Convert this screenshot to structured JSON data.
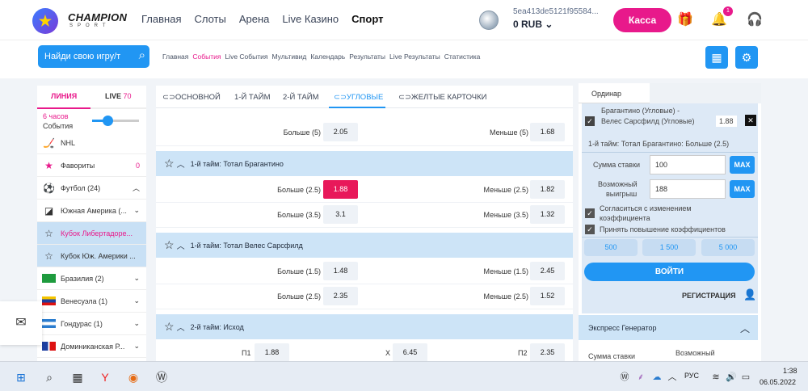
{
  "header": {
    "logo_title": "CHAMPION",
    "logo_sub": "SPORT",
    "nav": [
      "Главная",
      "Слоты",
      "Арена",
      "Live Казино",
      "Спорт"
    ],
    "account_id": "5ea413de5121f95584...",
    "balance": "0 RUB",
    "cashier": "Касса",
    "notif_count": "1"
  },
  "subheader": {
    "search": "Найди свою игру/т",
    "links": [
      "Главная",
      "События",
      "Live События",
      "Мультивид",
      "Календарь",
      "Результаты",
      "Live Результаты",
      "Статистика"
    ],
    "active_link": "События"
  },
  "left": {
    "tab_line": "ЛИНИЯ",
    "tab_live": "LIVE",
    "live_count": "70",
    "period": "6 часов",
    "events": "События",
    "items": [
      {
        "label": "NHL",
        "right": ""
      },
      {
        "label": "Фавориты",
        "right": "0"
      },
      {
        "label": "Футбол (24)",
        "right": "^"
      },
      {
        "label": "Южная Америка (...",
        "right": "v"
      },
      {
        "label": "Кубок Либертадоре...",
        "right": ""
      },
      {
        "label": "Кубок Юж. Америки ...",
        "right": ""
      },
      {
        "label": "Бразилия (2)",
        "right": "v"
      },
      {
        "label": "Венесуэла (1)",
        "right": "v"
      },
      {
        "label": "Гондурас (1)",
        "right": "v"
      },
      {
        "label": "Доминиканская Р...",
        "right": "v"
      }
    ]
  },
  "center": {
    "tabs": [
      "ОСНОВНОЙ",
      "1-Й ТАЙМ",
      "2-Й ТАЙМ",
      "УГЛОВЫЕ",
      "ЖЕЛТЫЕ КАРТОЧКИ"
    ],
    "active_tab": "УГЛОВЫЕ",
    "top_row": {
      "l_label": "Больше (5)",
      "l_val": "2.05",
      "r_label": "Меньше (5)",
      "r_val": "1.68"
    },
    "groups": [
      {
        "title": "1-й тайм: Тотал Брагантино",
        "rows": [
          {
            "l_label": "Больше (2.5)",
            "l_val": "1.88",
            "r_label": "Меньше (2.5)",
            "r_val": "1.82"
          },
          {
            "l_label": "Больше (3.5)",
            "l_val": "3.1",
            "r_label": "Меньше (3.5)",
            "r_val": "1.32"
          }
        ]
      },
      {
        "title": "1-й тайм: Тотал Велес Сарсфилд",
        "rows": [
          {
            "l_label": "Больше (1.5)",
            "l_val": "1.48",
            "r_label": "Меньше (1.5)",
            "r_val": "2.45"
          },
          {
            "l_label": "Больше (2.5)",
            "l_val": "2.35",
            "r_label": "Меньше (2.5)",
            "r_val": "1.52"
          }
        ]
      },
      {
        "title": "2-й тайм: Исход",
        "rows": [
          {
            "a_label": "П1",
            "a_val": "1.88",
            "b_label": "Х",
            "b_val": "6.45",
            "c_label": "П2",
            "c_val": "2.35"
          }
        ]
      }
    ]
  },
  "betslip": {
    "tab": "Ординар",
    "match_line1": "Брагантино (Угловые) -",
    "match_line2": "Велес Сарсфилд (Угловые)",
    "odds": "1.88",
    "selection": "1-й тайм: Тотал Брагантино: Больше (2.5)",
    "stake_label": "Сумма ставки",
    "stake_value": "100",
    "win_label1": "Возможный",
    "win_label2": "выигрыш",
    "win_value": "188",
    "max": "MAX",
    "accept1a": "Согласиться с изменением",
    "accept1b": "коэффициента",
    "accept2": "Принять повышение коэффициентов",
    "quick": [
      "500",
      "1 500",
      "5 000"
    ],
    "enter": "ВОЙТИ",
    "register": "РЕГИСТРАЦИЯ",
    "express": "Экспресс Генератор",
    "exp_stake": "Сумма ставки",
    "exp_win": "Возможный"
  },
  "taskbar": {
    "lang": "РУС",
    "time": "1:38",
    "date": "06.05.2022"
  },
  "colors": {
    "accent": "#2196f3",
    "brand": "#e8198b",
    "hot_odd": "#e8185a"
  }
}
